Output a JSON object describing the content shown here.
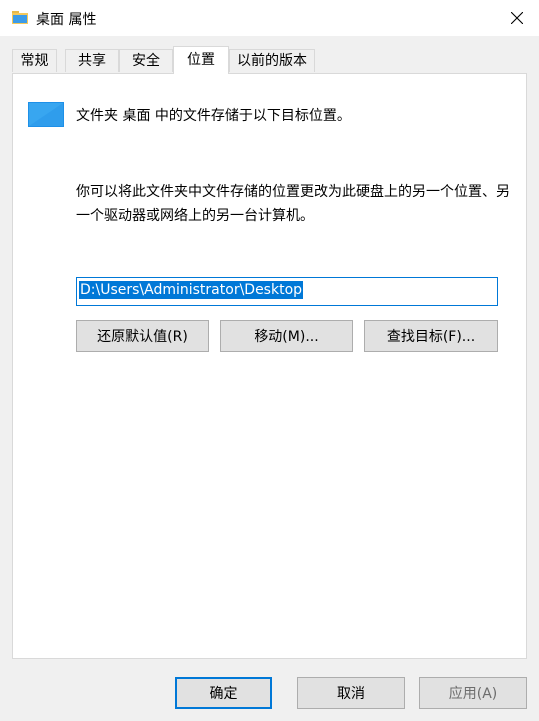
{
  "window": {
    "title": "桌面 属性"
  },
  "tabs": [
    {
      "label": "常规"
    },
    {
      "label": "共享"
    },
    {
      "label": "安全"
    },
    {
      "label": "位置"
    },
    {
      "label": "以前的版本"
    }
  ],
  "location": {
    "description": "文件夹 桌面 中的文件存储于以下目标位置。",
    "instructions": "你可以将此文件夹中文件存储的位置更改为此硬盘上的另一个位置、另一个驱动器或网络上的另一台计算机。",
    "path_value": "D:\\Users\\Administrator\\Desktop",
    "restore_default_label": "还原默认值(R)",
    "move_label": "移动(M)...",
    "find_target_label": "查找目标(F)..."
  },
  "footer": {
    "ok_label": "确定",
    "cancel_label": "取消",
    "apply_label": "应用(A)"
  },
  "colors": {
    "accent": "#0078d7",
    "folder": "#1e90e8"
  }
}
